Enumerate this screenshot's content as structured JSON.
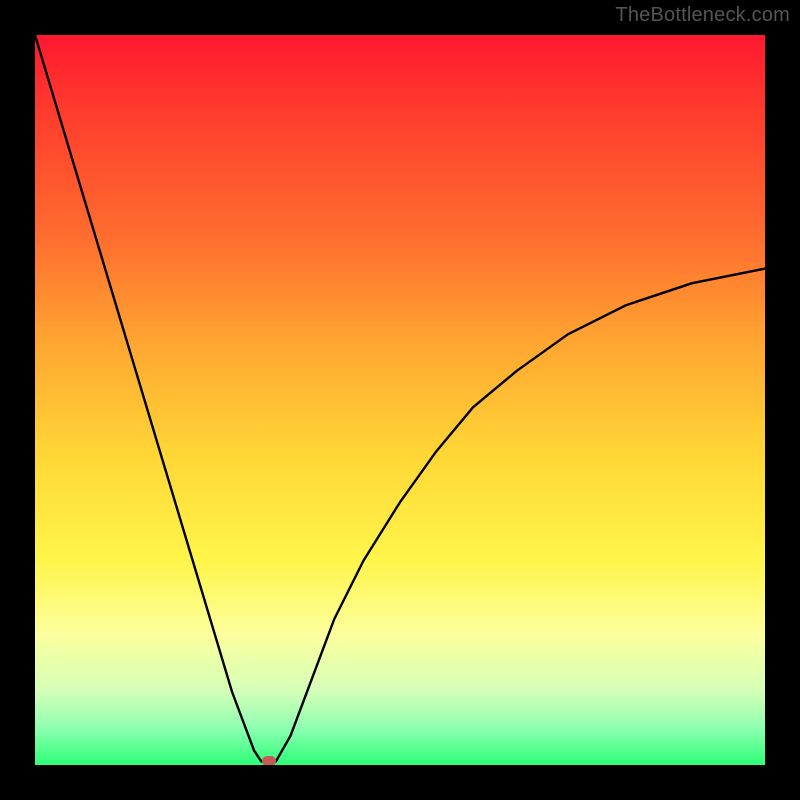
{
  "watermark": "TheBottleneck.com",
  "chart_data": {
    "type": "line",
    "title": "",
    "xlabel": "",
    "ylabel": "",
    "xlim": [
      0,
      100
    ],
    "ylim": [
      0,
      100
    ],
    "grid": false,
    "legend": false,
    "gradient_stops": [
      {
        "pos": 0,
        "color": "#ff1830"
      },
      {
        "pos": 10,
        "color": "#ff3a2d"
      },
      {
        "pos": 28,
        "color": "#ff6e2f"
      },
      {
        "pos": 42,
        "color": "#ffa531"
      },
      {
        "pos": 58,
        "color": "#ffd836"
      },
      {
        "pos": 72,
        "color": "#fff54a"
      },
      {
        "pos": 82,
        "color": "#fdff9d"
      },
      {
        "pos": 90,
        "color": "#d3ffb8"
      },
      {
        "pos": 95,
        "color": "#8cffb0"
      },
      {
        "pos": 100,
        "color": "#2cff77"
      }
    ],
    "series": [
      {
        "name": "bottleneck-curve",
        "x": [
          0,
          3,
          6,
          9,
          12,
          15,
          18,
          21,
          24,
          27,
          30,
          31,
          32,
          33,
          35,
          38,
          41,
          45,
          50,
          55,
          60,
          66,
          73,
          81,
          90,
          100
        ],
        "y": [
          100,
          90,
          80,
          70,
          60,
          50,
          40,
          30,
          20,
          10,
          2,
          0.5,
          0.5,
          0.5,
          4,
          12,
          20,
          28,
          36,
          43,
          49,
          54,
          59,
          63,
          66,
          68
        ]
      }
    ],
    "marker": {
      "x": 32,
      "y": 0.5,
      "color": "#c65a56",
      "shape": "rounded-rect"
    }
  }
}
